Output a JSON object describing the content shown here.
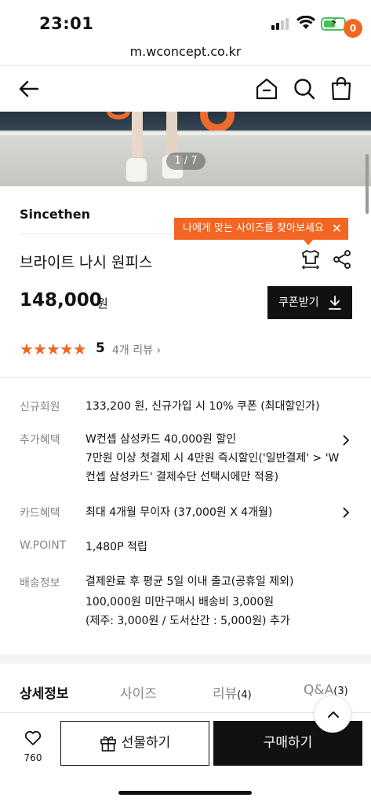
{
  "status": {
    "time": "23:01"
  },
  "browser": {
    "url": "m.wconcept.co.kr"
  },
  "nav": {
    "cart_count": "0"
  },
  "hero": {
    "counter": "1 / 7"
  },
  "product": {
    "brand": "Sincethen",
    "name": "브라이트 나시 원피스",
    "price": "148,000",
    "price_unit": "원",
    "rating": "5",
    "review_link": "4개 리뷰 ›"
  },
  "size_tooltip": {
    "text": "나에게 맞는 사이즈를 찾아보세요"
  },
  "coupon_button": {
    "label": "쿠폰받기"
  },
  "info": [
    {
      "label": "신규회원",
      "lines": [
        "133,200 원, 신규가입 시 10% 쿠폰 (최대할인가)"
      ]
    },
    {
      "label": "추가혜택",
      "lines": [
        "W컨셉 삼성카드 40,000원 할인",
        "7만원 이상 첫결제 시 4만원 즉시할인('일반결제' > 'W",
        "컨셉 삼성카드' 결제수단 선택시에만 적용)"
      ]
    },
    {
      "label": "카드혜택",
      "lines": [
        "최대 4개월 무이자 (37,000원 X 4개월)"
      ]
    },
    {
      "label": "W.POINT",
      "lines": [
        "1,480P 적립"
      ]
    },
    {
      "label": "배송정보",
      "lines": [
        "결제완료 후 평균 5일 이내 출고(공휴일 제외)",
        "100,000원 미만구매시 배송비 3,000원",
        "(제주: 3,000원 / 도서산간 : 5,000원) 추가"
      ]
    }
  ],
  "tabs": [
    {
      "label": "상세정보",
      "count": ""
    },
    {
      "label": "사이즈",
      "count": ""
    },
    {
      "label": "리뷰",
      "count": "(4)"
    },
    {
      "label": "Q&A",
      "count": "(3)"
    }
  ],
  "bottom": {
    "wish_count": "760",
    "gift_label": "선물하기",
    "buy_label": "구매하기"
  },
  "colors": {
    "accent": "#f26522",
    "primary": "#111111"
  }
}
